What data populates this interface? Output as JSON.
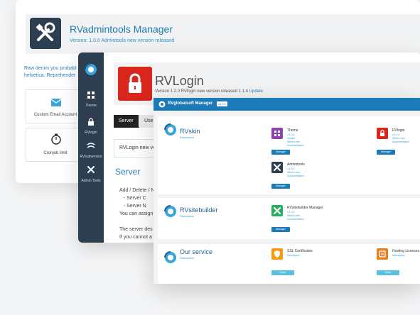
{
  "admintools": {
    "title": "RVadmintools Manager",
    "version_line": "Version: 1.0.0 Admintools new version released",
    "intro_text": "Raw denim you probabl helvetica. Reprehender",
    "cards": [
      "Custom Email Account",
      "Cronjob limit"
    ]
  },
  "rvlogin": {
    "sidebar": [
      {
        "label": "Theme",
        "icon": "theme-icon"
      },
      {
        "label": "RVlogin",
        "icon": "lock-icon"
      },
      {
        "label": "RVsubversion",
        "icon": "subversion-icon"
      },
      {
        "label": "Admin Tools",
        "icon": "tools-icon"
      }
    ],
    "title": "RVLogin",
    "version_line": "Version 1.2.0 RVlogin new version released 1.1.4",
    "update_link": "Update",
    "tabs": [
      "Server",
      "Users"
    ],
    "notice": "RVLogin new version released",
    "section_heading": "Server",
    "body_lines": [
      "Add / Delete / N",
      "   - Server C",
      "   - Server N",
      "You can assign",
      "",
      "The server des",
      "If you cannot a"
    ]
  },
  "manager": {
    "title": "RVglobalsoft Manager",
    "badge": "v1.0.0",
    "sections": [
      {
        "name": "RVskin",
        "desc": "Description",
        "products": [
          {
            "name": "Theme",
            "lines": [
              "v 1.0.0",
              "Update",
              "What's new",
              "Documentation"
            ],
            "button": "Manager",
            "color": "#8e44ad",
            "icon": "theme-icon"
          },
          {
            "name": "RVlogin",
            "lines": [
              "v 1.2.0",
              "What's new",
              "Documentation"
            ],
            "button": "Manager",
            "color": "#d9261c",
            "icon": "lock-icon"
          },
          {
            "name": "Admintools",
            "lines": [
              "v 1.0.0",
              "What's new",
              "Documentation"
            ],
            "button": "Manager",
            "color": "#2c3e50",
            "icon": "tools-icon"
          }
        ]
      },
      {
        "name": "RVsitebuilder",
        "desc": "Description",
        "products": [
          {
            "name": "RVsitebuilder Manager",
            "lines": [
              "v 1.0.0",
              "What's new",
              "Documentation"
            ],
            "button": "Manager",
            "color": "#27ae60",
            "icon": "sitebuilder-icon"
          }
        ]
      },
      {
        "name": "Our service",
        "desc": "Description",
        "products": [
          {
            "name": "SSL Certificates",
            "lines": [
              "Description"
            ],
            "button": "Order",
            "color": "#f39c12",
            "icon": "ssl-icon"
          },
          {
            "name": "Hosting Licenses",
            "lines": [
              "Description"
            ],
            "button": "Order",
            "color": "#e67e22",
            "icon": "license-icon"
          }
        ]
      }
    ]
  }
}
